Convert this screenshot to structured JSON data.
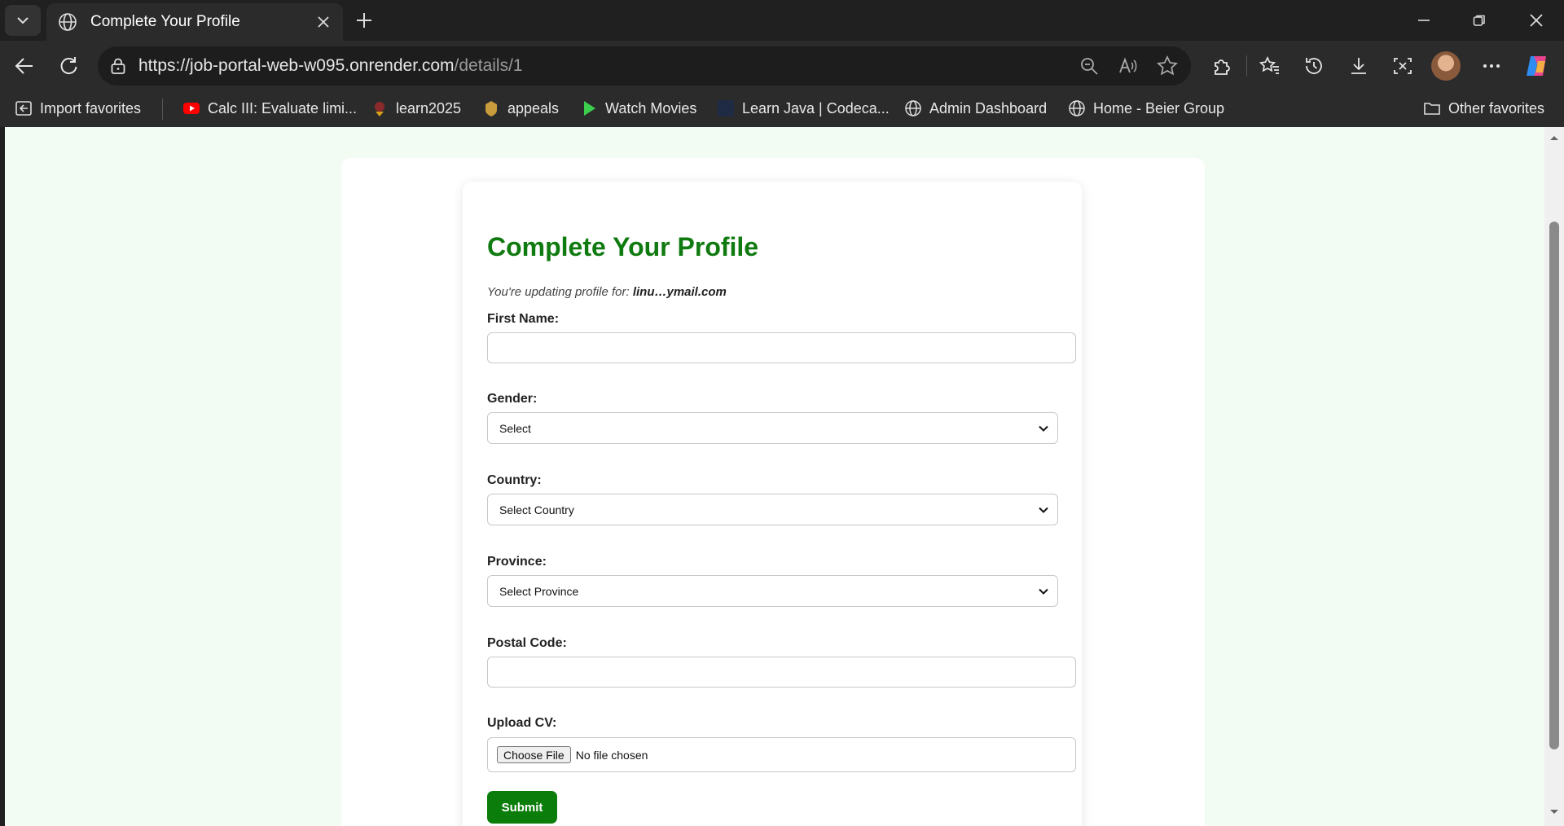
{
  "browser": {
    "tab_title": "Complete Your Profile",
    "url_host": "https://job-portal-web-w095.onrender.com",
    "url_path": "/details/1",
    "favorites": [
      {
        "label": "Import favorites",
        "icon": "import-icon"
      },
      {
        "label": "Calc III: Evaluate limi...",
        "icon": "youtube-icon"
      },
      {
        "label": "learn2025",
        "icon": "bookmark-icon"
      },
      {
        "label": "appeals",
        "icon": "bookmark-icon"
      },
      {
        "label": "Watch Movies",
        "icon": "play-icon"
      },
      {
        "label": "Learn Java | Codeca...",
        "icon": "codecademy-icon"
      },
      {
        "label": "Admin Dashboard",
        "icon": "globe-icon"
      },
      {
        "label": "Home - Beier Group",
        "icon": "globe-icon"
      }
    ],
    "other_favorites": "Other favorites"
  },
  "form": {
    "title": "Complete Your Profile",
    "info_prefix": "You're updating profile for:",
    "info_email": "linu…ymail.com",
    "first_name_label": "First Name:",
    "first_name_value": "",
    "gender_label": "Gender:",
    "gender_selected": "Select",
    "country_label": "Country:",
    "country_selected": "Select Country",
    "province_label": "Province:",
    "province_selected": "Select Province",
    "postal_label": "Postal Code:",
    "postal_value": "",
    "cv_label": "Upload CV:",
    "choose_file_label": "Choose File",
    "file_status": "No file chosen",
    "submit_label": "Submit"
  },
  "colors": {
    "title_green": "#0f7a0f",
    "submit_green": "#0a7d0a",
    "page_bg": "#f2fcf2"
  }
}
